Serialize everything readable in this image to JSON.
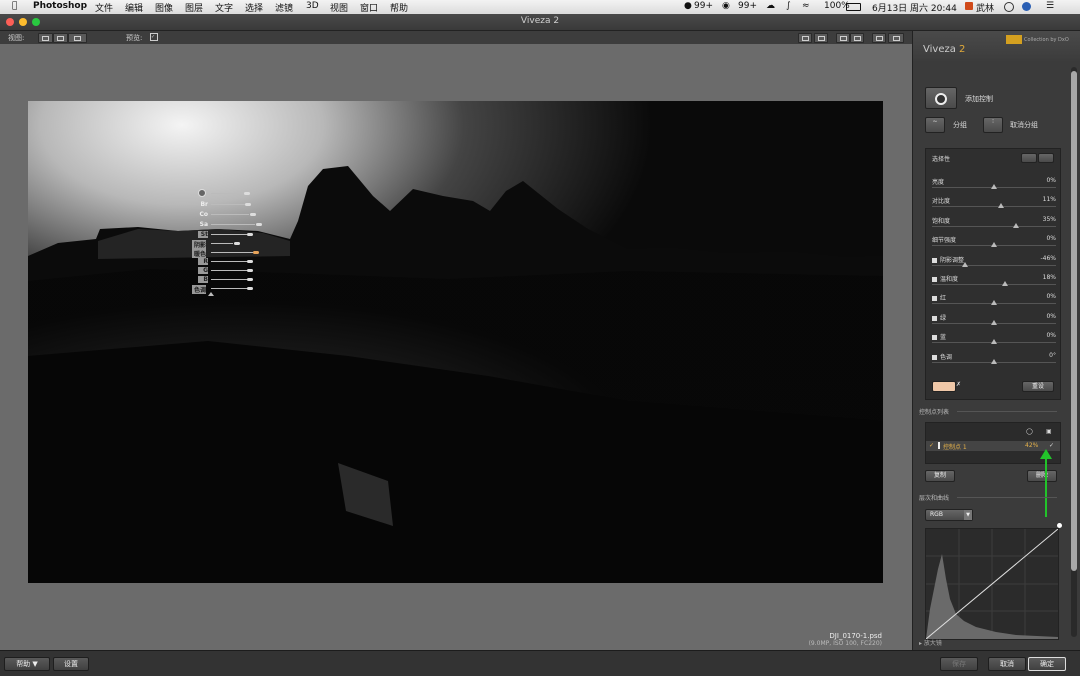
{
  "menubar": {
    "apple_icon": "apple-icon",
    "app_name": "Photoshop",
    "menus": [
      "文件",
      "编辑",
      "图像",
      "图层",
      "文字",
      "选择",
      "滤镜",
      "3D",
      "视图",
      "窗口",
      "帮助"
    ],
    "status": {
      "qq_count": "99+",
      "wechat_count": "99+",
      "battery": "100%",
      "datetime": "6月13日 周六  20:44",
      "user": "武林"
    }
  },
  "window": {
    "title": "Viveza 2"
  },
  "toolbar": {
    "view_label": "视图:",
    "preview_label": "预览:"
  },
  "image": {
    "filename": "DJI_0170-1.psd",
    "meta": "(9.0MP, ISO 100, FC220)"
  },
  "control_point_overlay": {
    "labels": [
      "Br",
      "Co",
      "Sa",
      "St",
      "阴影",
      "暖色",
      "R",
      "G",
      "B",
      "色调"
    ]
  },
  "panel": {
    "brand": "Viveza",
    "brand_version": "2",
    "collection": "Collection by DxO",
    "add_control": "添加控制",
    "group": "分组",
    "ungroup": "取消分组",
    "selectivity_title": "选择性",
    "sliders": [
      {
        "name": "亮度",
        "value": "0%",
        "checkbox": false,
        "pos": 0.5
      },
      {
        "name": "对比度",
        "value": "11%",
        "checkbox": false,
        "pos": 0.555
      },
      {
        "name": "饱和度",
        "value": "35%",
        "checkbox": false,
        "pos": 0.675
      },
      {
        "name": "细节强度",
        "value": "0%",
        "checkbox": false,
        "pos": 0.5
      },
      {
        "name": "阴影调整",
        "value": "-46%",
        "checkbox": true,
        "pos": 0.27
      },
      {
        "name": "温和度",
        "value": "18%",
        "checkbox": true,
        "pos": 0.59
      },
      {
        "name": "红",
        "value": "0%",
        "checkbox": true,
        "pos": 0.5
      },
      {
        "name": "绿",
        "value": "0%",
        "checkbox": true,
        "pos": 0.5
      },
      {
        "name": "蓝",
        "value": "0%",
        "checkbox": true,
        "pos": 0.5
      },
      {
        "name": "色调",
        "value": "0°",
        "checkbox": true,
        "pos": 0.5
      }
    ],
    "reset_label": "重设",
    "control_list_title": "控制点列表",
    "control_point": {
      "name": "控制点 1",
      "value": "42%"
    },
    "copy_label": "复制",
    "delete_label": "删除",
    "curves_title": "层次和曲线",
    "channel": "RGB",
    "loupe_label": "放大镜"
  },
  "bottombar": {
    "help": "帮助 ▼",
    "settings": "设置",
    "save": "保存",
    "cancel": "取消",
    "ok": "确定"
  },
  "colors": {
    "accent": "#e0a93a",
    "arrow": "#22c32a",
    "swatch": "#f0c8a8"
  }
}
